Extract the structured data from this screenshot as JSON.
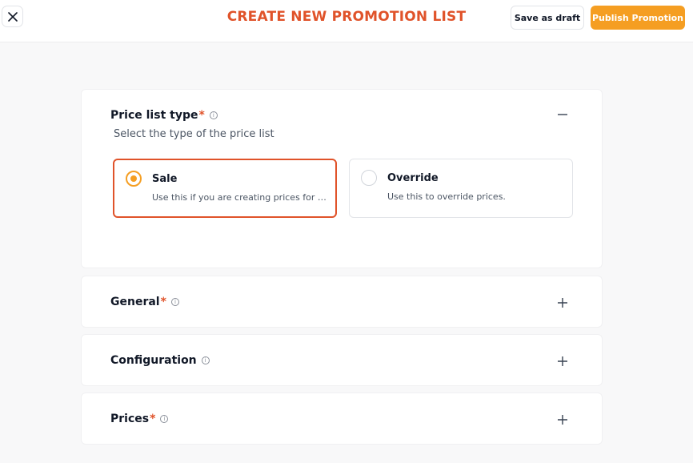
{
  "header": {
    "title": "CREATE NEW PROMOTION LIST",
    "save_draft_label": "Save as draft",
    "publish_label": "Publish Promotion",
    "accent_color": "#e0532a",
    "publish_color": "#f59e22"
  },
  "sections": {
    "price_list_type": {
      "title": "Price list type",
      "required_mark": "*",
      "subtitle": "Select the type of the price list",
      "expanded": true,
      "options": [
        {
          "title": "Sale",
          "description": "Use this if you are creating prices for a...",
          "selected": true
        },
        {
          "title": "Override",
          "description": "Use this to override prices.",
          "selected": false
        }
      ]
    },
    "general": {
      "title": "General",
      "required_mark": "*"
    },
    "configuration": {
      "title": "Configuration"
    },
    "prices": {
      "title": "Prices",
      "required_mark": "*"
    }
  },
  "icons": {
    "close": "close-icon",
    "info": "info-icon",
    "collapse": "minus-icon",
    "expand": "plus-icon"
  }
}
